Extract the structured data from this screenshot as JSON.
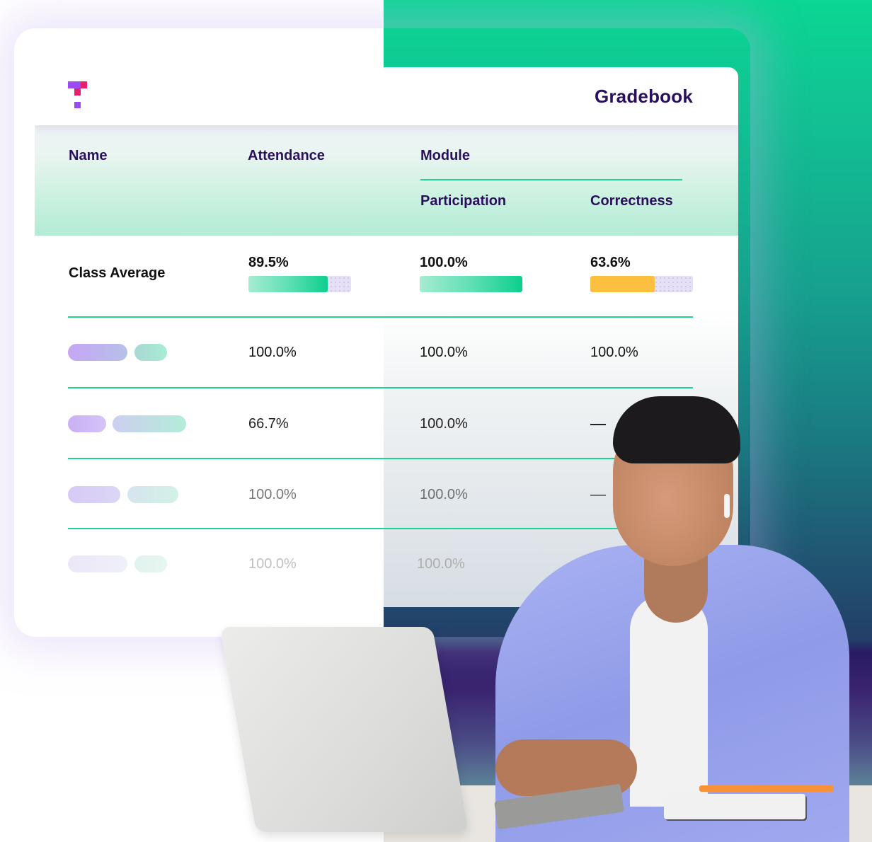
{
  "app": {
    "title": "Gradebook",
    "logo_icon": "tinkercad-style-t-logo"
  },
  "table": {
    "headers": {
      "name": "Name",
      "attendance": "Attendance",
      "module": "Module",
      "participation": "Participation",
      "correctness": "Correctness"
    },
    "class_average": {
      "label": "Class Average",
      "attendance": {
        "value": "89.5%",
        "fraction": 0.77,
        "color": "#0ccf8c"
      },
      "participation": {
        "value": "100.0%",
        "fraction": 1.0,
        "color": "#0ccf8c"
      },
      "correctness": {
        "value": "63.6%",
        "fraction": 0.63,
        "color": "#fdbf3f"
      }
    },
    "rows": [
      {
        "name": "redacted-student-name",
        "attendance": "100.0%",
        "participation": "100.0%",
        "correctness": "100.0%"
      },
      {
        "name": "redacted-student-name",
        "attendance": "66.7%",
        "participation": "100.0%",
        "correctness": "—"
      },
      {
        "name": "redacted-student-name",
        "attendance": "100.0%",
        "participation": "100.0%",
        "correctness": "—"
      },
      {
        "name": "redacted-student-name",
        "attendance": "100.0%",
        "participation": "100.0%",
        "correctness": "—"
      }
    ]
  },
  "colors": {
    "brand_purple": "#2a0f5c",
    "accent_green": "#1fd394",
    "logo_purple": "#9b4af0",
    "logo_pink": "#e91e73",
    "warning_yellow": "#fdbf3f"
  },
  "illustration": {
    "subject": "person-typing-on-laptop"
  }
}
